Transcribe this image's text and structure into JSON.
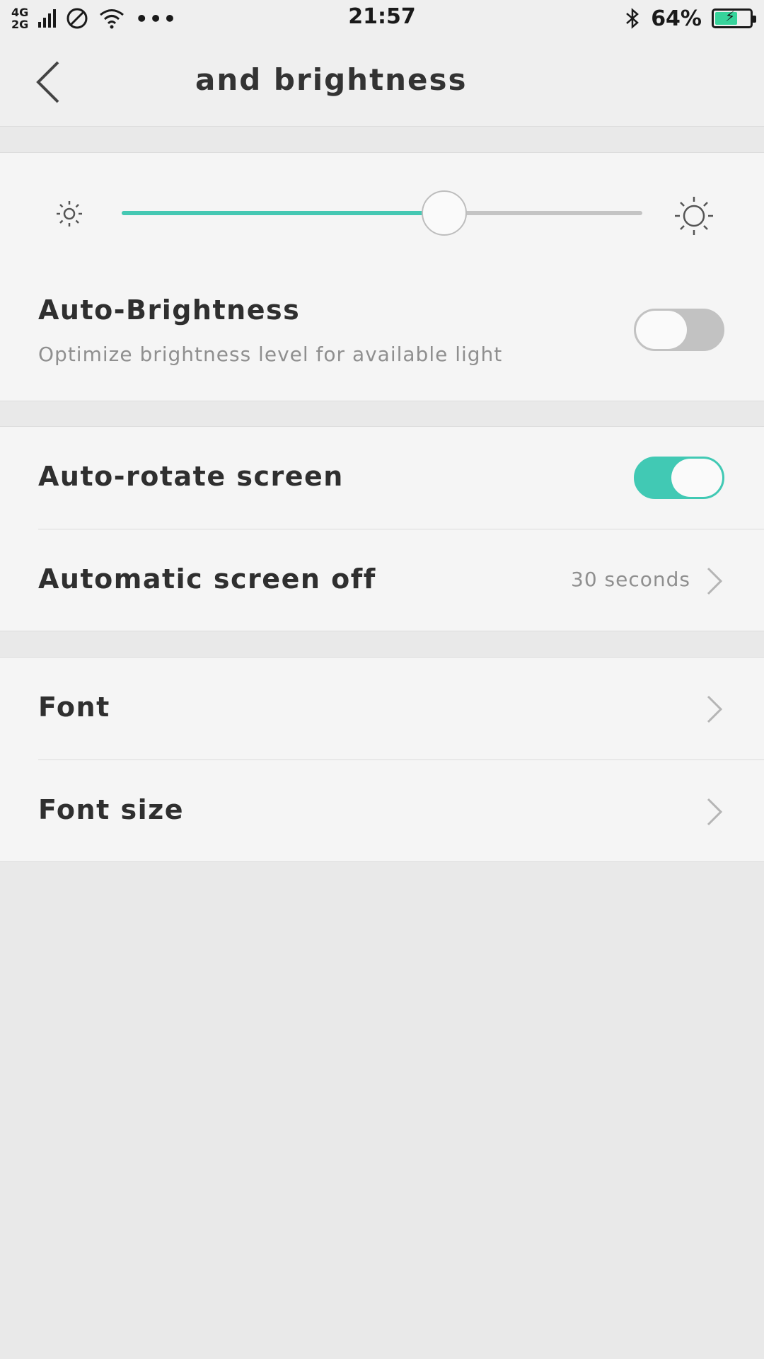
{
  "status_bar": {
    "network_top": "4G",
    "network_bottom": "2G",
    "time": "21:57",
    "battery_percent": "64%",
    "battery_level": 0.64,
    "icons": [
      "signal-icon",
      "do-not-disturb-icon",
      "wifi-icon",
      "more-icon",
      "bluetooth-icon",
      "battery-charging-icon"
    ]
  },
  "header": {
    "title": "and brightness",
    "back_icon": "back-arrow-icon"
  },
  "brightness": {
    "level": 0.62,
    "min_icon": "sun-small-icon",
    "max_icon": "sun-large-icon",
    "accent": "#45c8b3"
  },
  "auto_brightness": {
    "label": "Auto-Brightness",
    "description": "Optimize brightness level for available light",
    "enabled": false
  },
  "auto_rotate": {
    "label": "Auto-rotate screen",
    "enabled": true
  },
  "screen_off": {
    "label": "Automatic screen off",
    "value": "30 seconds"
  },
  "font": {
    "label": "Font"
  },
  "font_size": {
    "label": "Font size"
  }
}
